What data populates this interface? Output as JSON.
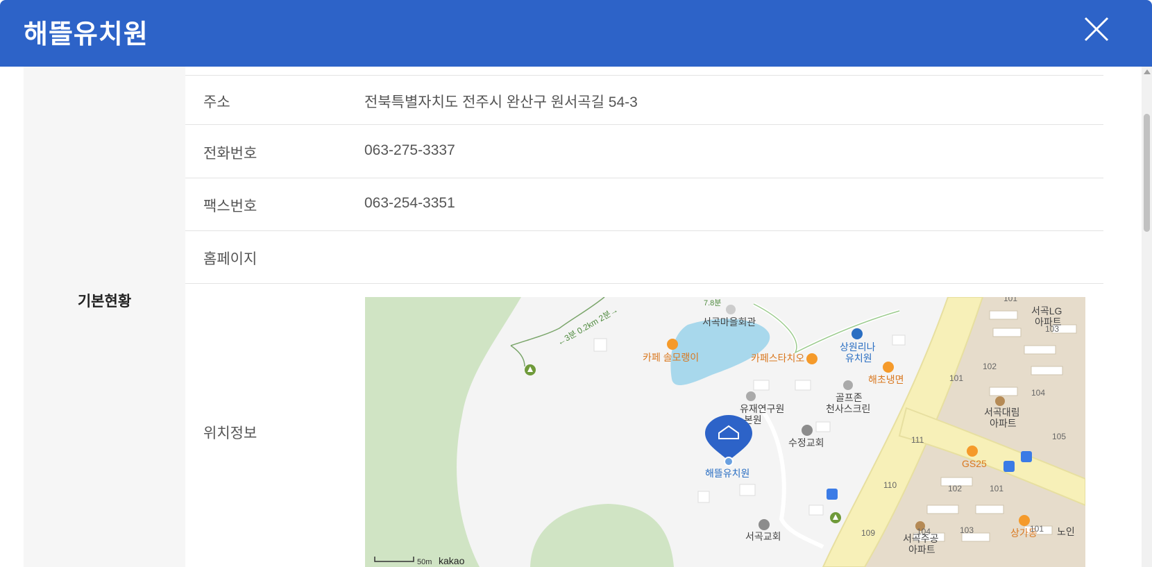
{
  "header": {
    "title": "해뜰유치원"
  },
  "section": {
    "label": "기본현황"
  },
  "rows": [
    {
      "label": "주소",
      "value": "전북특별자치도 전주시 완산구 원서곡길 54-3"
    },
    {
      "label": "전화번호",
      "value": "063-275-3337"
    },
    {
      "label": "팩스번호",
      "value": "063-254-3351"
    },
    {
      "label": "홈페이지",
      "value": ""
    },
    {
      "label": "위치정보"
    }
  ],
  "map": {
    "poi": {
      "village_hall": "서곡마을회관",
      "cafe1": "카페 솔모랭이",
      "cafe2": "카페스타치오",
      "kinder2_line1": "상원리나",
      "kinder2_line2": "유치원",
      "restaurant": "해초냉면",
      "golf_line1": "골프존",
      "golf_line2": "천사스크린",
      "institute_line1": "유재연구원",
      "institute_line2": "본원",
      "marker": "해뜰유치원",
      "church1": "수정교회",
      "church2": "서곡교회",
      "apt1_line1": "서곡LG",
      "apt1_line2": "아파트",
      "apt2_line1": "서곡대림",
      "apt2_line2": "아파트",
      "apt3_line1": "서곡주공",
      "apt3_line2": "아파트",
      "gs25": "GS25",
      "mall": "상가동",
      "senior": "노인",
      "trail": "←3분 0.2km 2분→",
      "trail_top": "7.8분"
    },
    "bldg_numbers": [
      "101",
      "103",
      "102",
      "104",
      "101",
      "105",
      "111",
      "110",
      "102",
      "101",
      "109",
      "104",
      "103",
      "101"
    ],
    "scale": "50m",
    "brand": "kakao",
    "colors": {
      "water": "#a8d8ec",
      "park": "#d0e4c4",
      "road": "#f7f0b8",
      "apt": "#e6dccb",
      "marker": "#2d63c8",
      "poi_orange": "#d9771e",
      "poi_blue": "#2a6ec2"
    }
  },
  "colors": {
    "header_bg": "#2d63c8"
  }
}
